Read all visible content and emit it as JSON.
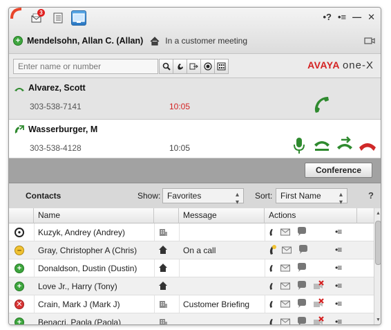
{
  "titlebar": {
    "mail_badge": "3",
    "help_glyph": "•?",
    "menu_glyph": "•≡",
    "minimize_glyph": "—",
    "close_glyph": "✕"
  },
  "user": {
    "status_glyph": "+",
    "name": "Mendelsohn, Allan C. (Allan)",
    "status_text": "In a customer meeting"
  },
  "search": {
    "placeholder": "Enter name or number"
  },
  "logo": {
    "brand": "AVAYA",
    "product": "one-X"
  },
  "calls": [
    {
      "name": "Alvarez, Scott",
      "number": "303-538-7141",
      "time": "10:05",
      "state": "incoming",
      "time_color": "#d42121"
    },
    {
      "name": "Wasserburger, M",
      "number": "303-538-4128",
      "time": "10:05",
      "state": "active",
      "time_color": "#444444"
    }
  ],
  "conference_label": "Conference",
  "contacts": {
    "title": "Contacts",
    "show_label": "Show:",
    "show_value": "Favorites",
    "sort_label": "Sort:",
    "sort_value": "First Name",
    "help": "?",
    "columns": {
      "name": "Name",
      "message": "Message",
      "actions": "Actions"
    },
    "rows": [
      {
        "name": "Kuzyk, Andrey (Andrey)",
        "presence": "away",
        "location": "office",
        "message": "",
        "icons": [
          "phone",
          "mail",
          "chat"
        ]
      },
      {
        "name": "Gray, Christopher A (Chris)",
        "presence": "busy",
        "location": "home",
        "message": "On a call",
        "icons": [
          "phone-busy",
          "mail",
          "chat"
        ]
      },
      {
        "name": "Donaldson, Dustin (Dustin)",
        "presence": "available",
        "location": "home",
        "message": "",
        "icons": [
          "phone",
          "mail",
          "chat"
        ]
      },
      {
        "name": "Love Jr., Harry (Tony)",
        "presence": "available",
        "location": "home",
        "message": "",
        "icons": [
          "phone",
          "mail",
          "chat",
          "video-off"
        ]
      },
      {
        "name": "Crain, Mark J (Mark J)",
        "presence": "dnd",
        "location": "office",
        "message": "Customer Briefing",
        "icons": [
          "phone",
          "mail",
          "chat",
          "video-off"
        ]
      },
      {
        "name": "Benacri, Paola (Paola)",
        "presence": "available",
        "location": "office",
        "message": "",
        "icons": [
          "phone",
          "mail",
          "chat",
          "video-off"
        ]
      }
    ],
    "row_menu_glyph": "•≡"
  },
  "colors": {
    "accent_red": "#d42121",
    "call_green": "#2f8a2f",
    "hangup_red": "#d02828",
    "active_tab_blue": "#2a78c4"
  },
  "icons": {
    "top": [
      "phone-corner-icon",
      "mail-icon",
      "contacts-list-icon",
      "monitor-icon"
    ],
    "search_tools": [
      "magnifier-icon",
      "dial-icon",
      "transfer-icon",
      "record-icon",
      "keypad-icon"
    ]
  }
}
